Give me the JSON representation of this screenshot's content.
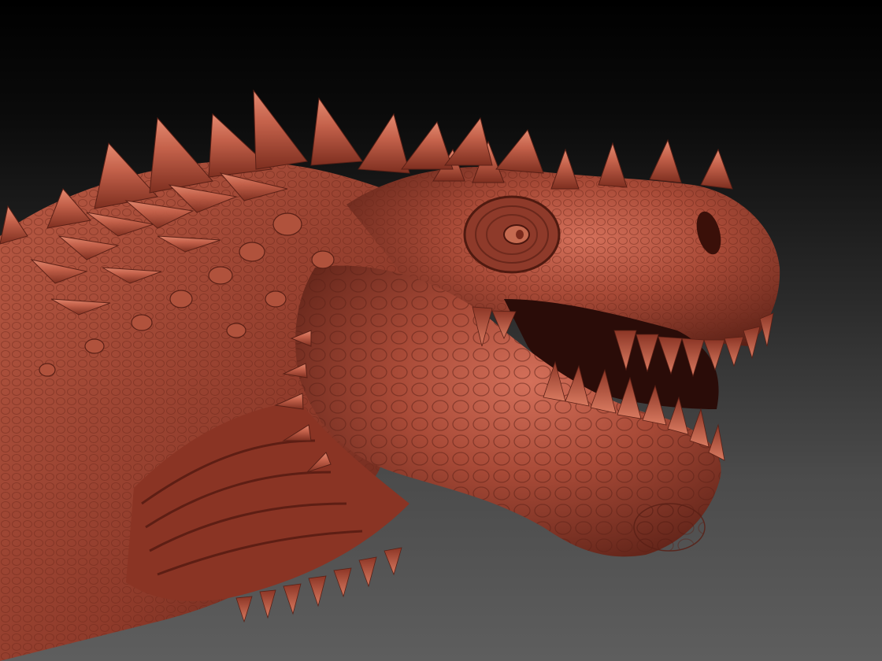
{
  "scene": {
    "subject": "dinosaur-head-sculpt",
    "colors": {
      "background_top": "#000000",
      "background_bottom": "#5e5e5e",
      "skin_base": "#a84a37",
      "skin_light": "#d9725a",
      "skin_dark": "#5a2016",
      "mouth_interior": "#2a0c08",
      "eye": "#c56a50"
    }
  }
}
